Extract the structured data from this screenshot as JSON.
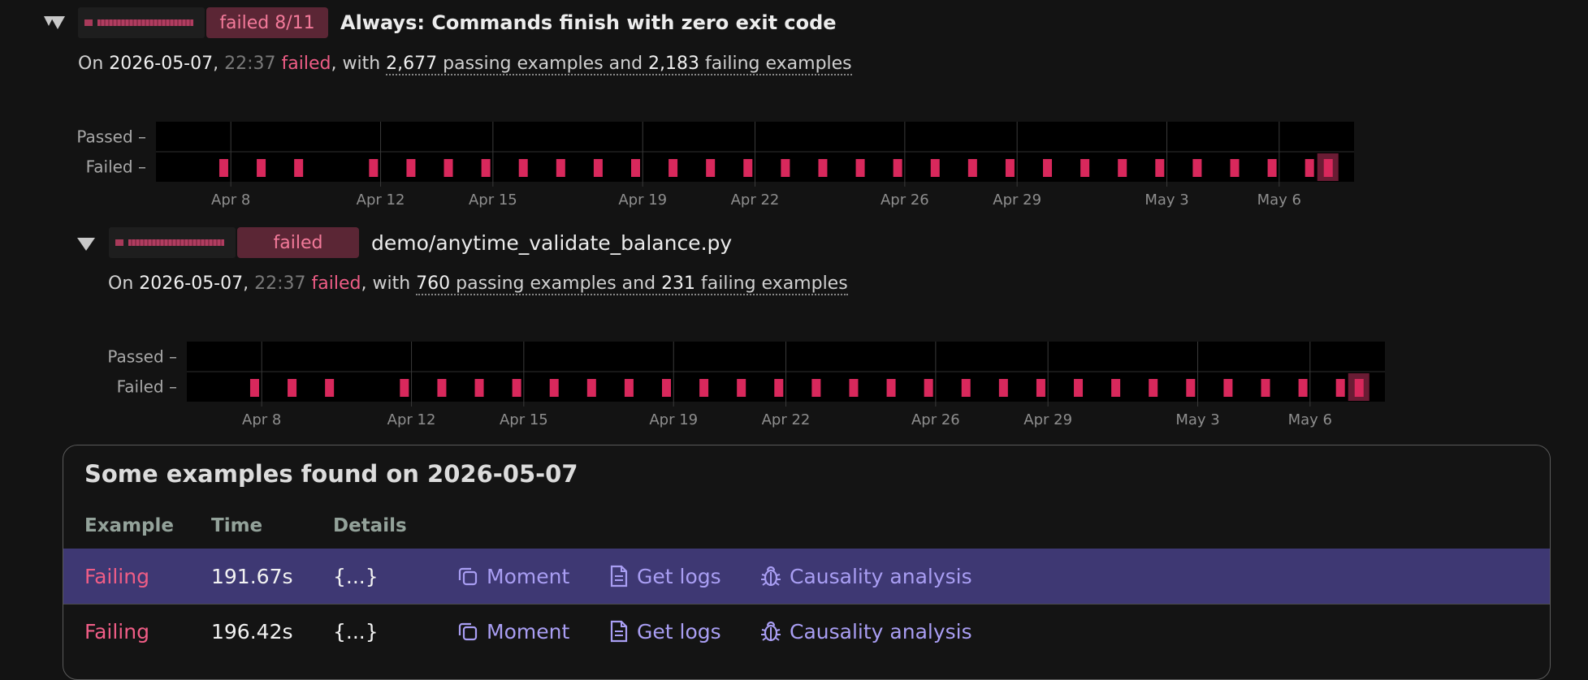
{
  "theme": {
    "fail": "#ef5d86",
    "mark": "#d8285c",
    "selected_row": "#3e3873",
    "link": "#a99ef3"
  },
  "property": {
    "badge": "failed 8/11",
    "title": "Always: Commands finish with zero exit code",
    "summary": {
      "prefix": "On ",
      "date": "2026-05-07",
      "sep": ", ",
      "time": "22:37",
      "status": "failed",
      "with": ", with ",
      "passing_count": "2,677",
      "passing_text": " passing examples and ",
      "failing_count": "2,183",
      "failing_text": " failing examples"
    }
  },
  "test": {
    "badge": "failed",
    "title": "demo/anytime_validate_balance.py",
    "summary": {
      "prefix": "On ",
      "date": "2026-05-07",
      "sep": ", ",
      "time": "22:37",
      "status": "failed",
      "with": ", with ",
      "passing_count": "760",
      "passing_text": " passing examples and ",
      "failing_count": "231",
      "failing_text": " failing examples"
    }
  },
  "timeline": {
    "rows": [
      "Passed",
      "Failed"
    ],
    "ticks": [
      "Apr 8",
      "Apr 12",
      "Apr 15",
      "Apr 19",
      "Apr 22",
      "Apr 26",
      "Apr 29",
      "May 3",
      "May 6"
    ],
    "tick_days": [
      2,
      6,
      9,
      13,
      16,
      20,
      23,
      27,
      30
    ],
    "domain_days": [
      0,
      32
    ],
    "failed_days": [
      1.8,
      2.8,
      3.8,
      5.8,
      6.8,
      7.8,
      8.8,
      9.8,
      10.8,
      11.8,
      12.8,
      13.8,
      14.8,
      15.8,
      16.8,
      17.8,
      18.8,
      19.8,
      20.8,
      21.8,
      22.8,
      23.8,
      24.8,
      25.8,
      26.8,
      27.8,
      28.8,
      29.8,
      30.8
    ],
    "selected_day": 31.3
  },
  "examples": {
    "title": "Some examples found on 2026-05-07",
    "headers": {
      "example": "Example",
      "time": "Time",
      "details": "Details"
    },
    "rows": [
      {
        "status": "Failing",
        "time": "191.67s",
        "details": "{...}",
        "moment": "Moment",
        "logs": "Get logs",
        "causality": "Causality analysis",
        "selected": true
      },
      {
        "status": "Failing",
        "time": "196.42s",
        "details": "{...}",
        "moment": "Moment",
        "logs": "Get logs",
        "causality": "Causality analysis",
        "selected": false
      }
    ]
  }
}
